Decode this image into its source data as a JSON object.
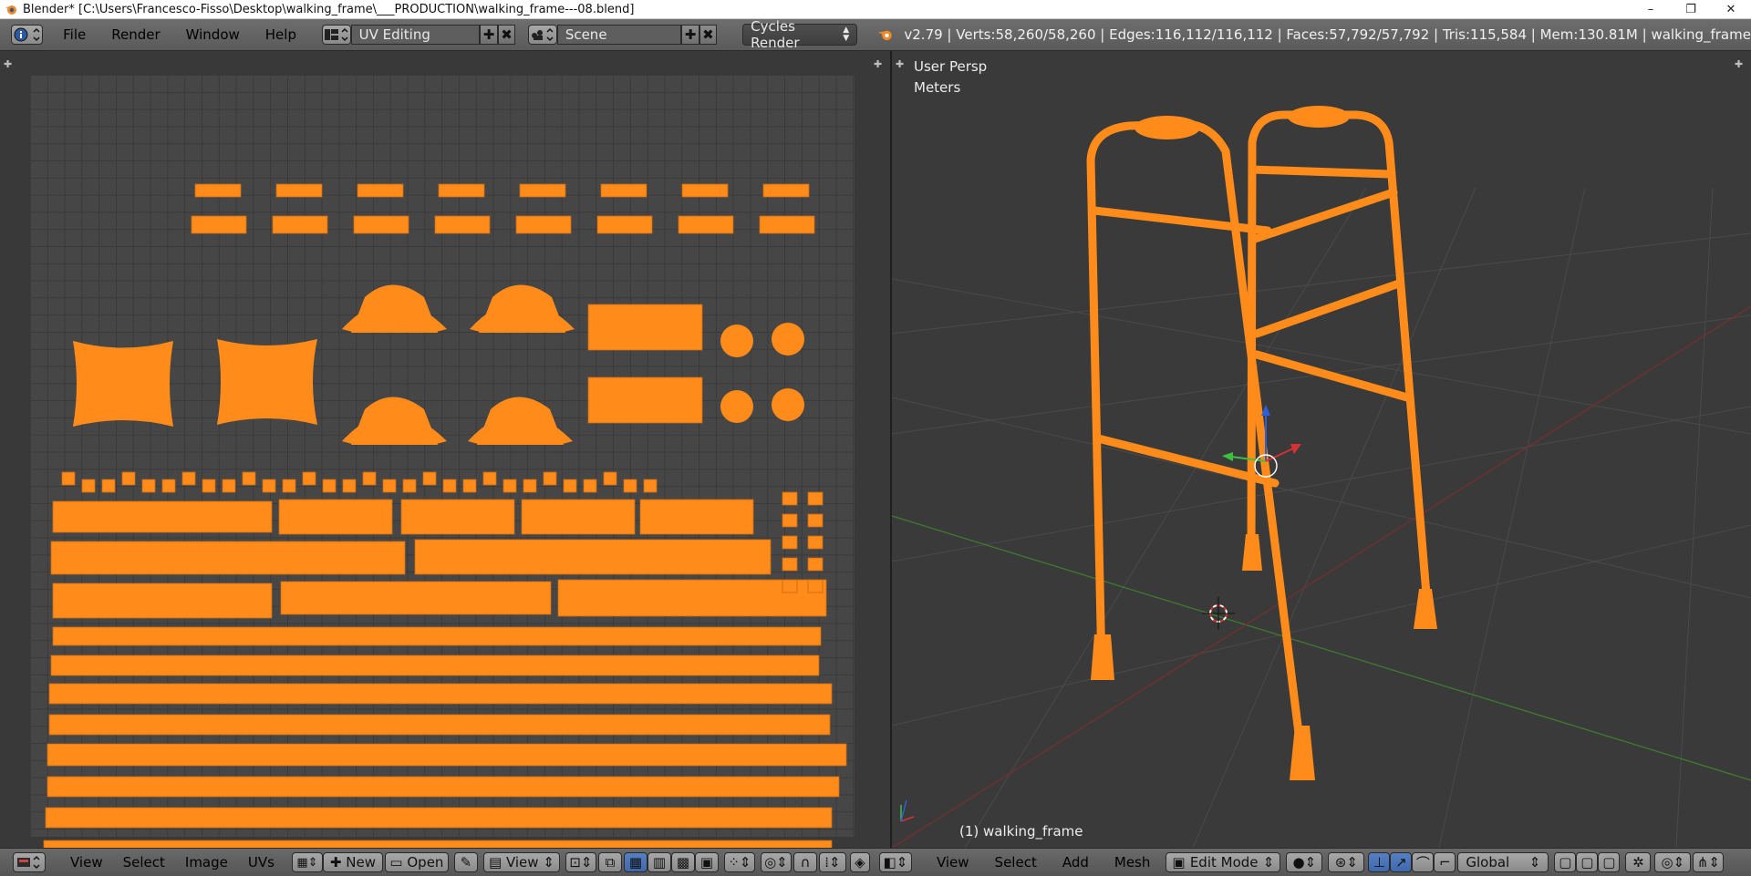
{
  "window": {
    "title": "Blender* [C:\\Users\\Francesco-Fisso\\Desktop\\walking_frame\\___PRODUCTION\\walking_frame---08.blend]",
    "controls": [
      "–",
      "❐",
      "✕"
    ]
  },
  "info_header": {
    "menus": [
      "File",
      "Render",
      "Window",
      "Help"
    ],
    "screen_layout": "UV Editing",
    "scene": "Scene",
    "render_engine": "Cycles Render",
    "stats": "v2.79 | Verts:58,260/58,260 | Edges:116,112/116,112 | Faces:57,792/57,792 | Tris:115,584 | Mem:130.81M | walking_frame"
  },
  "uv_editor": {
    "menus": [
      "View",
      "Select",
      "Image",
      "UVs"
    ],
    "new_label": "New",
    "open_label": "Open",
    "view_label": "View"
  },
  "viewport_3d": {
    "overlay_view": "User Persp",
    "overlay_units": "Meters",
    "object_label": "(1) walking_frame",
    "menus": [
      "View",
      "Select",
      "Add",
      "Mesh"
    ],
    "mode": "Edit Mode",
    "orientation": "Global"
  },
  "colors": {
    "uv_orange": "#ff8c1a",
    "header_gray": "#6a6a6a",
    "viewport_bg": "#3a3a3a"
  }
}
